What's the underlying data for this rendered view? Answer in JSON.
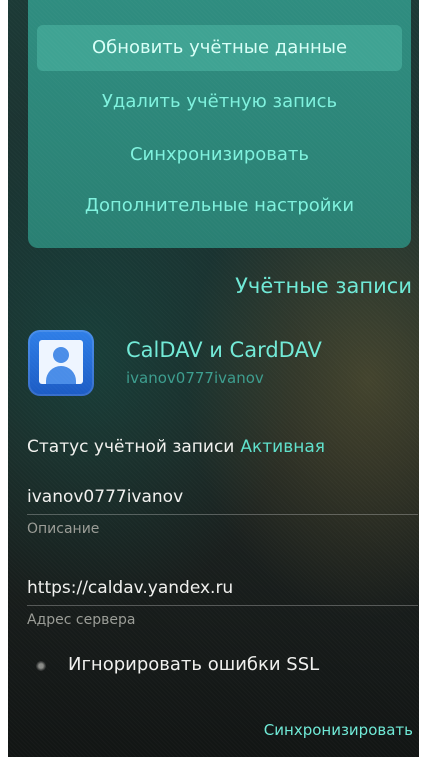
{
  "pulley_menu": {
    "items": [
      {
        "label": "Обновить учётные данные",
        "highlighted": true
      },
      {
        "label": "Удалить учётную запись",
        "highlighted": false
      },
      {
        "label": "Синхронизировать",
        "highlighted": false
      },
      {
        "label": "Дополнительные настройки",
        "highlighted": false
      }
    ]
  },
  "header": {
    "title": "Учётные записи"
  },
  "account": {
    "icon": "contact-account-icon",
    "name": "CalDAV и CardDAV",
    "username": "ivanov0777ivanov"
  },
  "status": {
    "label": "Статус учётной записи",
    "value": "Активная"
  },
  "fields": {
    "description": {
      "value": "ivanov0777ivanov",
      "label": "Описание"
    },
    "server": {
      "value": "https://caldav.yandex.ru",
      "label": "Адрес сервера"
    }
  },
  "ssl": {
    "label": "Игнорировать ошибки SSL",
    "checked": false
  },
  "footer": {
    "sync_label": "Синхронизировать"
  },
  "colors": {
    "accent": "#6fe9d6",
    "menu_background": "#2f8d80",
    "menu_highlight": "#3fa393"
  }
}
